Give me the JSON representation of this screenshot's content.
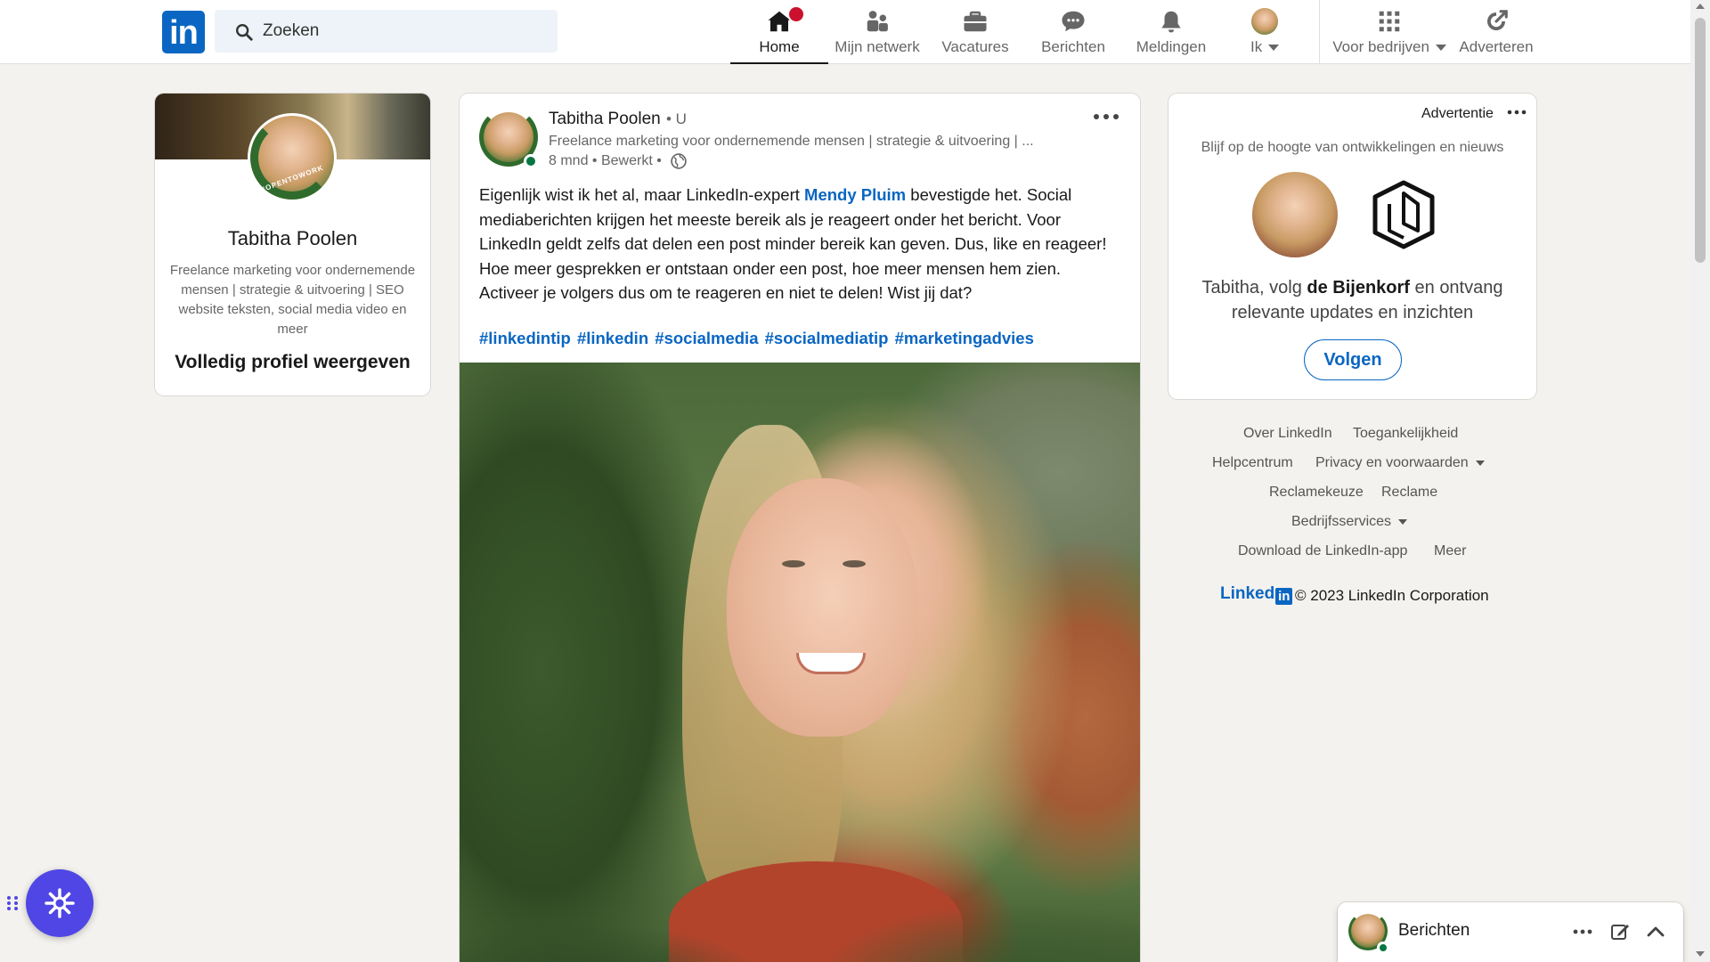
{
  "app": {
    "title": "LinkedIn"
  },
  "colors": {
    "brand": "#0a66c2",
    "badge": "#cb112d",
    "open_to_work": "#2f6b2c",
    "online": "#057642",
    "assistant": "#4f46e5"
  },
  "nav": {
    "logo": "in",
    "search_placeholder": "Zoeken",
    "items": [
      {
        "label": "Home",
        "icon": "home-icon",
        "active": true
      },
      {
        "label": "Mijn netwerk",
        "icon": "network-icon"
      },
      {
        "label": "Vacatures",
        "icon": "briefcase-icon"
      },
      {
        "label": "Berichten",
        "icon": "messaging-icon"
      },
      {
        "label": "Meldingen",
        "icon": "bell-icon"
      },
      {
        "label": "Ik",
        "icon": "avatar"
      },
      {
        "label": "Voor bedrijven",
        "icon": "grid-icon"
      },
      {
        "label": "Adverteren",
        "icon": "advertise-icon"
      }
    ]
  },
  "profile": {
    "name": "Tabitha Poolen",
    "headline": "Freelance marketing voor ondernemende mensen | strategie & uitvoering | SEO website teksten, social media video en meer",
    "badge": "#OPENTOWORK",
    "view_profile": "Volledig profiel weergeven"
  },
  "post": {
    "author": "Tabitha Poolen",
    "degree": "• U",
    "headline": "Freelance marketing voor ondernemende mensen | strategie & uitvoering | ...",
    "meta": "8 mnd • Bewerkt •",
    "text_before": "Eigenlijk wist ik het al, maar LinkedIn-expert ",
    "mention": "Mendy Pluim",
    "text_after": " bevestigde het. Social mediaberichten krijgen het meeste bereik als je reageert onder het bericht. Voor LinkedIn geldt zelfs dat delen een post minder bereik kan geven. Dus, like en reageer! Hoe meer gesprekken er ontstaan onder een post, hoe meer mensen hem zien. Activeer je volgers dus om te reageren en niet te delen! Wist jij dat?",
    "hashtags": [
      "#linkedintip",
      "#linkedin",
      "#socialmedia",
      "#socialmediatip",
      "#marketingadvies"
    ]
  },
  "ad": {
    "label": "Advertentie",
    "tagline": "Blijf op de hoogte van ontwikkelingen en nieuws",
    "text_before": "Tabitha, volg ",
    "company": "de Bijenkorf",
    "text_after": " en ontvang relevante updates en inzichten",
    "follow": "Volgen"
  },
  "footer": {
    "links": [
      {
        "label": "Over LinkedIn",
        "dropdown": false
      },
      {
        "label": "Toegankelijkheid",
        "dropdown": false
      },
      {
        "label": "Helpcentrum",
        "dropdown": false
      },
      {
        "label": "Privacy en voorwaarden",
        "dropdown": true
      },
      {
        "label": "Reclamekeuze",
        "dropdown": false
      },
      {
        "label": "Reclame",
        "dropdown": false
      },
      {
        "label": "Bedrijfsservices",
        "dropdown": true
      },
      {
        "label": "Download de LinkedIn-app",
        "dropdown": false
      },
      {
        "label": "Meer",
        "dropdown": false
      }
    ],
    "brand_text": "Linked",
    "brand_in": "in",
    "copyright": "© 2023 LinkedIn Corporation"
  },
  "messaging": {
    "title": "Berichten"
  }
}
